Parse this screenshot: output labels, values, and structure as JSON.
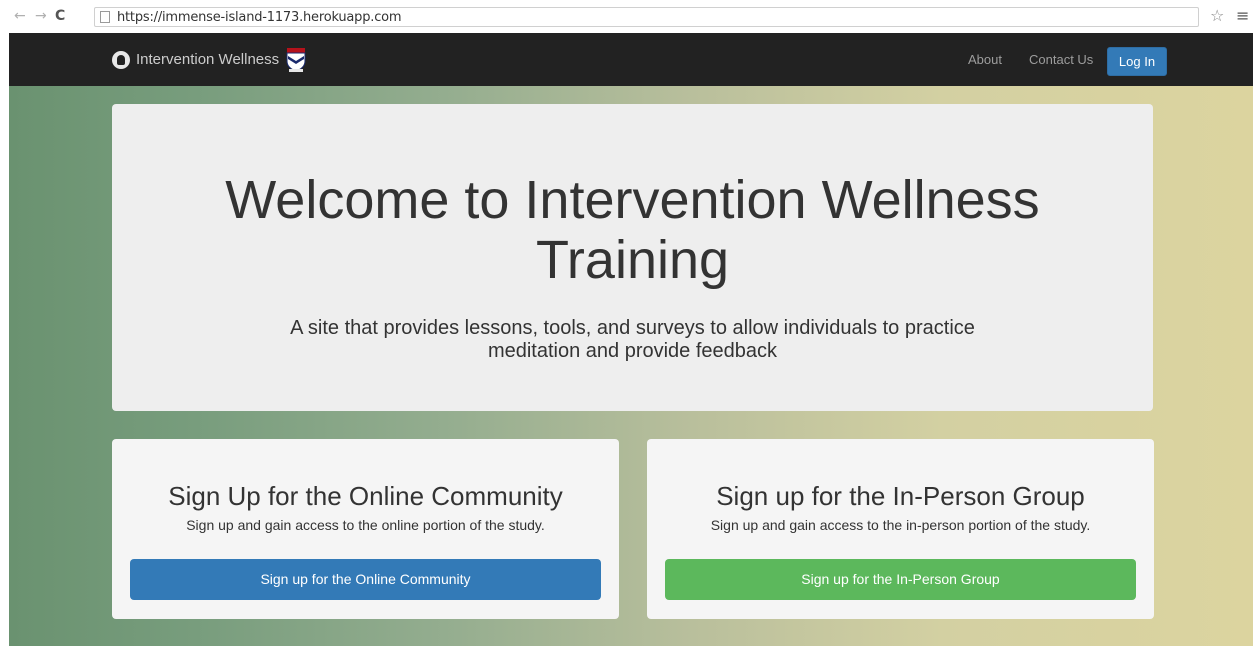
{
  "browser": {
    "back_icon": "←",
    "forward_icon": "→",
    "reload_icon": "C",
    "url": "https://immense-island-1173.herokuapp.com",
    "star_icon": "☆",
    "menu_icon": "≡"
  },
  "navbar": {
    "brand": "Intervention Wellness",
    "links": [
      "About",
      "Contact Us"
    ],
    "login": "Log In"
  },
  "hero": {
    "title": "Welcome to Intervention Wellness Training",
    "subtitle": "A site that provides lessons, tools, and surveys to allow individuals to practice meditation and provide feedback"
  },
  "cards": [
    {
      "title": "Sign Up for the Online Community",
      "description": "Sign up and gain access to the online portion of the study.",
      "button": "Sign up for the Online Community",
      "color": "#337ab7"
    },
    {
      "title": "Sign up for the In-Person Group",
      "description": "Sign up and gain access to the in-person portion of the study.",
      "button": "Sign up for the In-Person Group",
      "color": "#5cb85c"
    }
  ]
}
